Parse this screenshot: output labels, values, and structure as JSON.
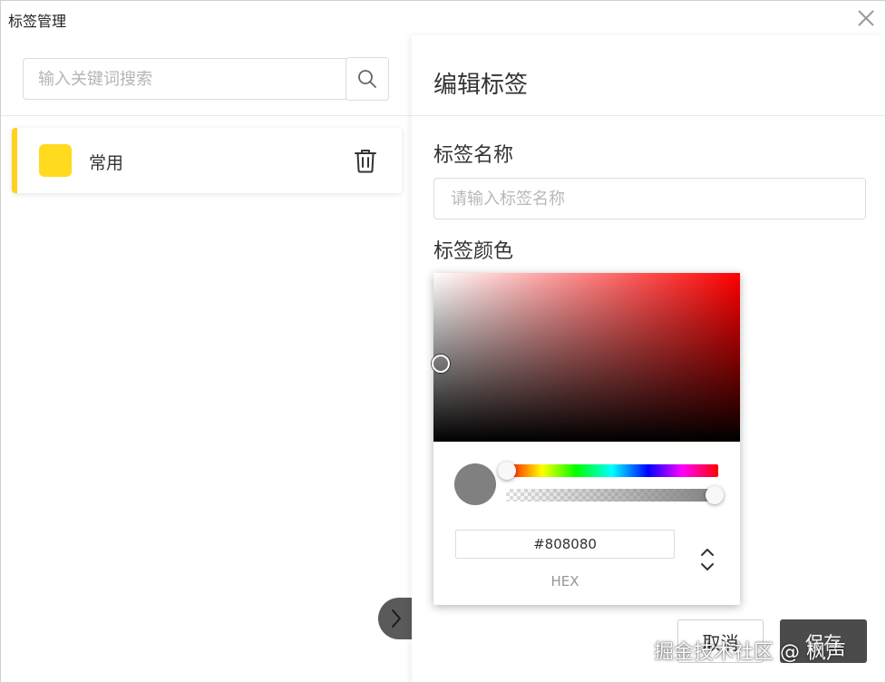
{
  "window": {
    "title": "标签管理"
  },
  "left": {
    "search": {
      "placeholder": "输入关键词搜索",
      "value": ""
    },
    "tags": [
      {
        "label": "常用",
        "color": "#ffda1f"
      }
    ]
  },
  "editor": {
    "title": "编辑标签",
    "name_label": "标签名称",
    "name_placeholder": "请输入标签名称",
    "name_value": "",
    "color_label": "标签颜色",
    "cancel_label": "取消",
    "save_label": "保存"
  },
  "picker": {
    "hex_value": "#808080",
    "mode_label": "HEX",
    "hue_color": "#ff0000",
    "alpha": 1
  },
  "watermark": "掘金技术社区 @ 枫声"
}
